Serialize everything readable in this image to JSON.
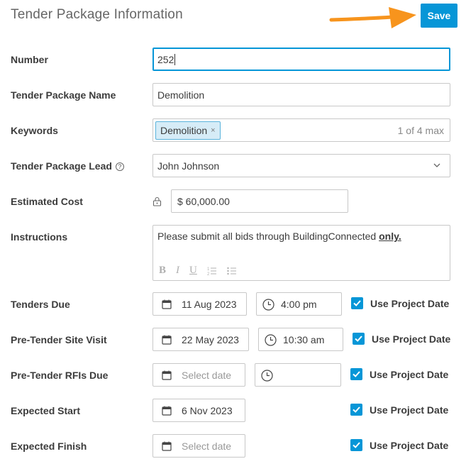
{
  "header": {
    "title": "Tender Package Information",
    "save_label": "Save"
  },
  "fields": {
    "number": {
      "label": "Number",
      "value": "252"
    },
    "name": {
      "label": "Tender Package Name",
      "value": "Demolition"
    },
    "keywords": {
      "label": "Keywords",
      "tag": "Demolition",
      "remove_glyph": "×",
      "count": "1 of 4 max"
    },
    "lead": {
      "label": "Tender Package Lead",
      "help_glyph": "?",
      "value": "John Johnson"
    },
    "cost": {
      "label": "Estimated Cost",
      "value": "$ 60,000.00"
    },
    "instructions": {
      "label": "Instructions",
      "text": "Please submit all bids through BuildingConnected ",
      "emphasis": "only.",
      "toolbar": [
        "B",
        "I",
        "U",
        "ordered-list",
        "bullet-list"
      ]
    }
  },
  "schedule": [
    {
      "label": "Tenders Due",
      "date": "11 Aug 2023",
      "time": "4:00 pm",
      "checkbox": "Use Project Date",
      "checked": true
    },
    {
      "label": "Pre-Tender Site Visit",
      "date": "22 May 2023",
      "time": "10:30 am",
      "checkbox": "Use Project Date",
      "checked": true
    },
    {
      "label": "Pre-Tender RFIs Due",
      "date_placeholder": "Select date",
      "time": "",
      "checkbox": "Use Project Date",
      "checked": true
    },
    {
      "label": "Expected Start",
      "date": "6 Nov 2023",
      "checkbox": "Use Project Date",
      "checked": true
    },
    {
      "label": "Expected Finish",
      "date_placeholder": "Select date",
      "checkbox": "Use Project Date",
      "checked": true
    }
  ],
  "colors": {
    "accent": "#0696d7",
    "arrow": "#f7941d",
    "tag_bg": "#d6ecf7"
  }
}
